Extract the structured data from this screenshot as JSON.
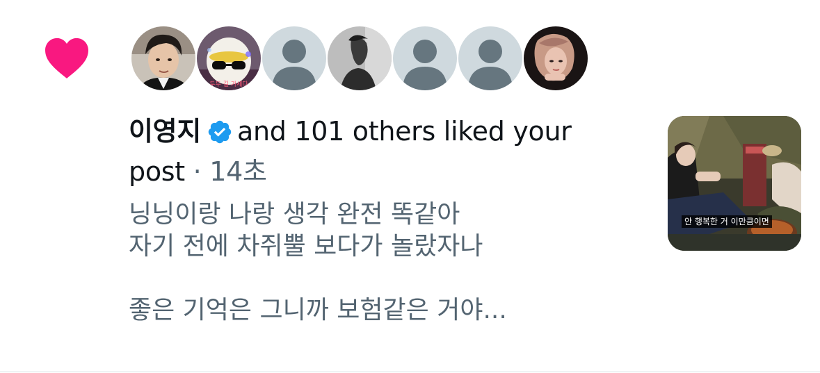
{
  "notification": {
    "type": "like",
    "icon": "heart-icon",
    "icon_color": "#f91880",
    "avatars": [
      {
        "kind": "photo",
        "description": "young man with short dark hair"
      },
      {
        "kind": "photo",
        "description": "white mascot with sunglasses",
        "caption": "두두 길 가세다"
      },
      {
        "kind": "default"
      },
      {
        "kind": "photo",
        "description": "grayscale profile of a person"
      },
      {
        "kind": "default"
      },
      {
        "kind": "default"
      },
      {
        "kind": "photo",
        "description": "woman with long hair, dark background"
      }
    ],
    "username": "이영지",
    "verified_icon": "verified-badge-icon",
    "verified_color": "#1d9bf0",
    "action_text": "and 101 others liked your",
    "action_text_cont": "post",
    "separator": "·",
    "time": "14초",
    "post_lines": [
      "닝닝이랑 나랑 생각 완전 똑같아",
      "자기 전에 차쥐뿔 보다가 놀랐자나",
      "",
      "좋은 기억은 그니까 보험같은 거야..."
    ],
    "thumbnail": {
      "caption": "안 행복한 거 이만큼이면"
    }
  }
}
